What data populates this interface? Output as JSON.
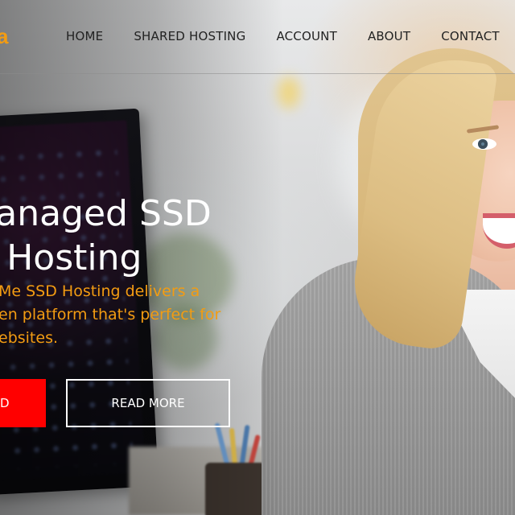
{
  "header": {
    "logo_fragment": "a",
    "nav": [
      "HOME",
      "SHARED HOSTING",
      "ACCOUNT",
      "ABOUT",
      "CONTACT"
    ]
  },
  "hero": {
    "headline_lines": [
      "lanaged SSD",
      "l Hosting"
    ],
    "subtext_lines": [
      "Me SSD Hosting delivers a",
      "en platform that's perfect for",
      "ebsites."
    ],
    "primary_button": "D",
    "secondary_button": "READ MORE"
  },
  "colors": {
    "accent": "#f39c12",
    "primary_button": "#ff0000",
    "nav_text": "#222222",
    "headline": "#ffffff"
  }
}
